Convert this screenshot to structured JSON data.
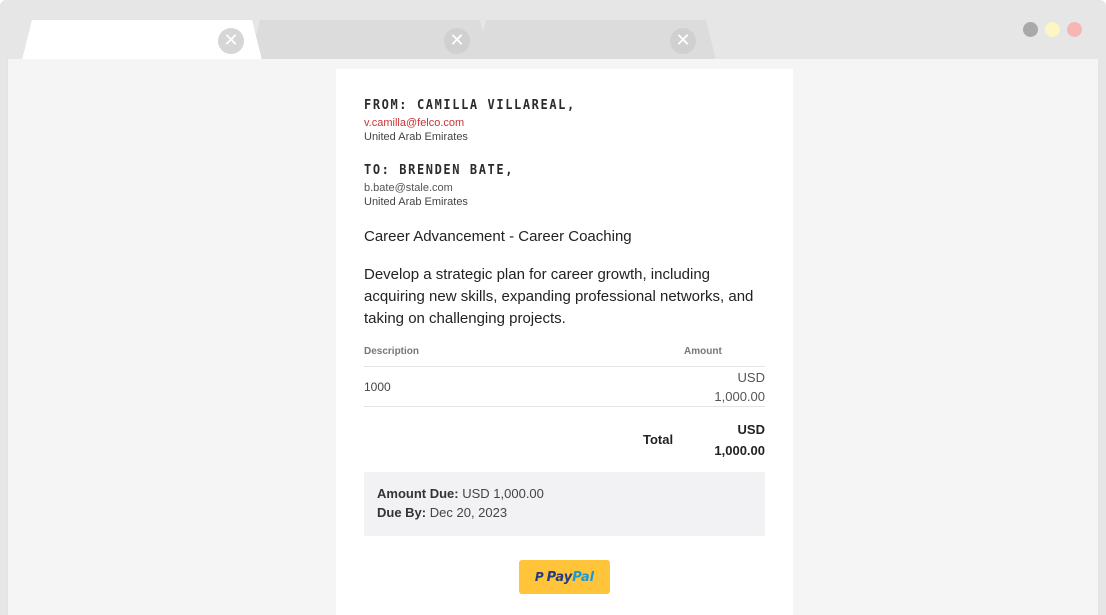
{
  "browser": {
    "tabs": [
      {
        "label": "",
        "active": true,
        "close_glyph": "✕"
      },
      {
        "label": "",
        "active": false,
        "close_glyph": "✕"
      },
      {
        "label": "",
        "active": false,
        "close_glyph": "✕"
      }
    ],
    "window_controls": [
      {
        "name": "minimize",
        "color": "#a9a9a9"
      },
      {
        "name": "maximize",
        "color": "#fbf6c4"
      },
      {
        "name": "close",
        "color": "#f6b6b6"
      }
    ]
  },
  "invoice": {
    "from": {
      "title": "FROM: CAMILLA VILLAREAL,",
      "email": "v.camilla@felco.com",
      "country": "United Arab Emirates"
    },
    "to": {
      "title": "TO: BRENDEN BATE,",
      "email": "b.bate@stale.com",
      "country": "United Arab Emirates"
    },
    "service_title": "Career Advancement - Career Coaching",
    "service_description": "Develop a strategic plan for career growth, including acquiring new skills, expanding professional networks, and taking on challenging projects.",
    "table": {
      "headers": {
        "description": "Description",
        "amount": "Amount"
      },
      "rows": [
        {
          "description": "1000",
          "amount_currency": "USD",
          "amount_value": "1,000.00"
        }
      ],
      "total_label": "Total",
      "total_currency": "USD",
      "total_value": "1,000.00"
    },
    "due": {
      "amount_label": "Amount Due:",
      "amount_value": "USD 1,000.00",
      "date_label": "Due By:",
      "date_value": "Dec 20, 2023"
    },
    "paypal": {
      "mark": "P",
      "pay": "Pay",
      "pal": "Pal",
      "bg_color": "#ffc439"
    }
  }
}
